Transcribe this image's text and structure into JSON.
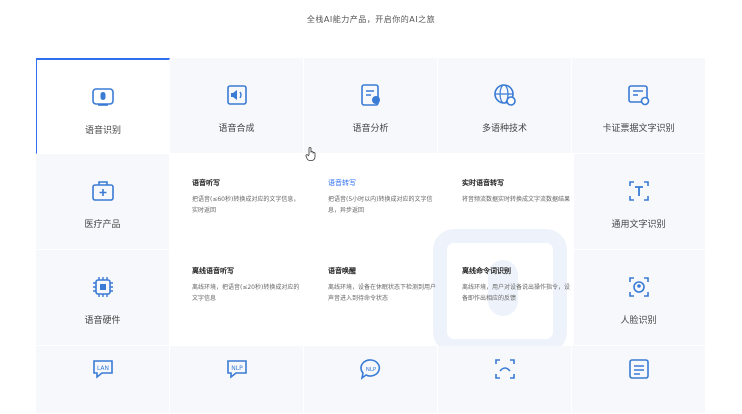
{
  "subtitle": "全栈AI能力产品，开启你的AI之旅",
  "accent_color": "#2f6ff0",
  "top_row": [
    {
      "label": "语音识别",
      "icon": "speech-recognition-icon"
    },
    {
      "label": "语音合成",
      "icon": "speech-synthesis-icon"
    },
    {
      "label": "语音分析",
      "icon": "speech-analysis-icon"
    },
    {
      "label": "多语种技术",
      "icon": "multilingual-globe-icon"
    },
    {
      "label": "卡证票据文字识别",
      "icon": "card-ocr-icon"
    }
  ],
  "left_col": [
    {
      "label": "医疗产品",
      "icon": "medical-kit-icon"
    },
    {
      "label": "语音硬件",
      "icon": "chip-icon"
    }
  ],
  "right_col": [
    {
      "label": "通用文字识别",
      "icon": "text-scan-icon"
    },
    {
      "label": "人脸识别",
      "icon": "face-scan-icon"
    }
  ],
  "bottom_row_icons": [
    "lan-icon",
    "nlp-icon",
    "nlp-bubble-icon",
    "face-landmark-icon",
    "document-list-icon"
  ],
  "bottom_row_badges": {
    "lan": "LAN",
    "nlp": "NLP",
    "nlp2": "NLP"
  },
  "panel_items": [
    {
      "title": "语音听写",
      "desc": "把语音(≤60秒)转换成对应的文字信息，实时返回"
    },
    {
      "title": "语音转写",
      "desc": "把语音(5小时以内)转换成对应的文字信息，异步返回"
    },
    {
      "title": "实时语音转写",
      "desc": "将音频流数据实时转换成文字流数据结果"
    },
    {
      "title": "离线语音听写",
      "desc": "离线环境，把语音(≤20秒)转换成对应的文字信息"
    },
    {
      "title": "语音唤醒",
      "desc": "离线环境，设备在休眠状态下检测到用户声音进入到待命令状态"
    },
    {
      "title": "离线命令词识别",
      "desc": "离线环境，用户对设备说出操作指令，设备即作出相应的反馈"
    }
  ]
}
